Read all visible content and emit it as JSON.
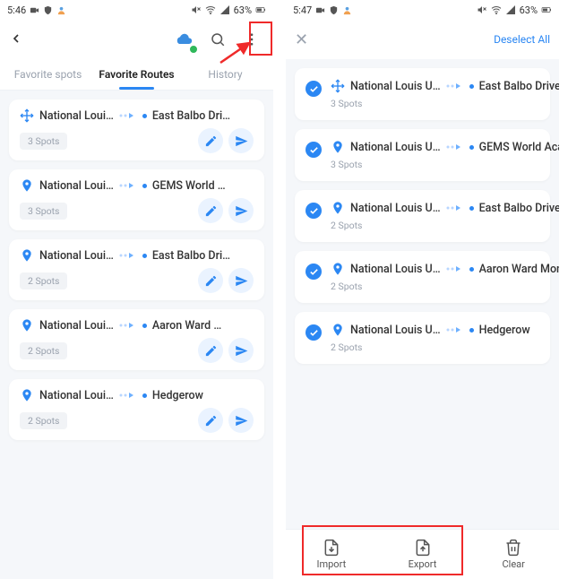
{
  "left": {
    "status": {
      "time": "5:46",
      "battery": "63%"
    },
    "tabs": {
      "favorite_spots": "Favorite spots",
      "favorite_routes": "Favorite Routes",
      "history": "History"
    },
    "routes": [
      {
        "from": "National Loui…",
        "to": "East Balbo Dri…",
        "spots": "3 Spots",
        "icon": "move"
      },
      {
        "from": "National Loui…",
        "to": "GEMS World …",
        "spots": "3 Spots",
        "icon": "pin"
      },
      {
        "from": "National Loui…",
        "to": "East Balbo Dri…",
        "spots": "2 Spots",
        "icon": "pin"
      },
      {
        "from": "National Loui…",
        "to": "Aaron Ward …",
        "spots": "2 Spots",
        "icon": "pin"
      },
      {
        "from": "National Loui…",
        "to": "Hedgerow",
        "spots": "2 Spots",
        "icon": "pin"
      }
    ]
  },
  "right": {
    "status": {
      "time": "5:47",
      "battery": "63%"
    },
    "deselect": "Deselect All",
    "routes": [
      {
        "from": "National Louis U…",
        "to": "East Balbo Drive",
        "spots": "3 Spots",
        "icon": "move"
      },
      {
        "from": "National Louis U…",
        "to": "GEMS World Aca…",
        "spots": "3 Spots",
        "icon": "pin"
      },
      {
        "from": "National Louis U…",
        "to": "East Balbo Drive",
        "spots": "2 Spots",
        "icon": "pin"
      },
      {
        "from": "National Louis U…",
        "to": "Aaron Ward Mon…",
        "spots": "2 Spots",
        "icon": "pin"
      },
      {
        "from": "National Louis U…",
        "to": "Hedgerow",
        "spots": "2 Spots",
        "icon": "pin"
      }
    ],
    "bottom": {
      "import": "Import",
      "export": "Export",
      "clear": "Clear"
    }
  }
}
